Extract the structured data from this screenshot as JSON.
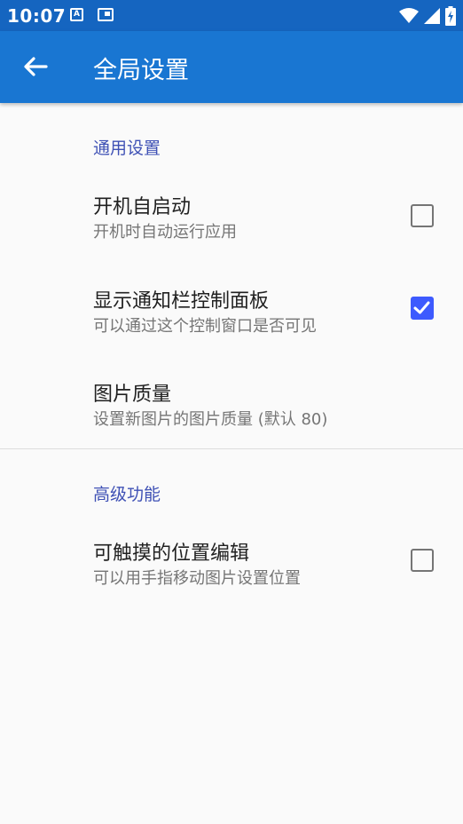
{
  "status_bar": {
    "time": "10:07",
    "notification_icons": [
      "a-icon",
      "card-icon"
    ],
    "system_icons": [
      "wifi-icon",
      "signal-icon",
      "battery-icon"
    ]
  },
  "app_bar": {
    "title": "全局设置",
    "back_icon": "arrow-back-icon"
  },
  "sections": [
    {
      "header": "通用设置",
      "items": [
        {
          "title": "开机自启动",
          "summary": "开机时自动运行应用",
          "checkbox": true,
          "checked": false
        },
        {
          "title": "显示通知栏控制面板",
          "summary": "可以通过这个控制窗口是否可见",
          "checkbox": true,
          "checked": true
        },
        {
          "title": "图片质量",
          "summary": "设置新图片的图片质量 (默认 80)",
          "checkbox": false
        }
      ]
    },
    {
      "header": "高级功能",
      "items": [
        {
          "title": "可触摸的位置编辑",
          "summary": "可以用手指移动图片设置位置",
          "checkbox": true,
          "checked": false
        }
      ]
    }
  ],
  "colors": {
    "status_bar": "#1565c0",
    "app_bar": "#1976d2",
    "section_header": "#3f51b5",
    "checkbox_checked": "#3d5afe"
  }
}
